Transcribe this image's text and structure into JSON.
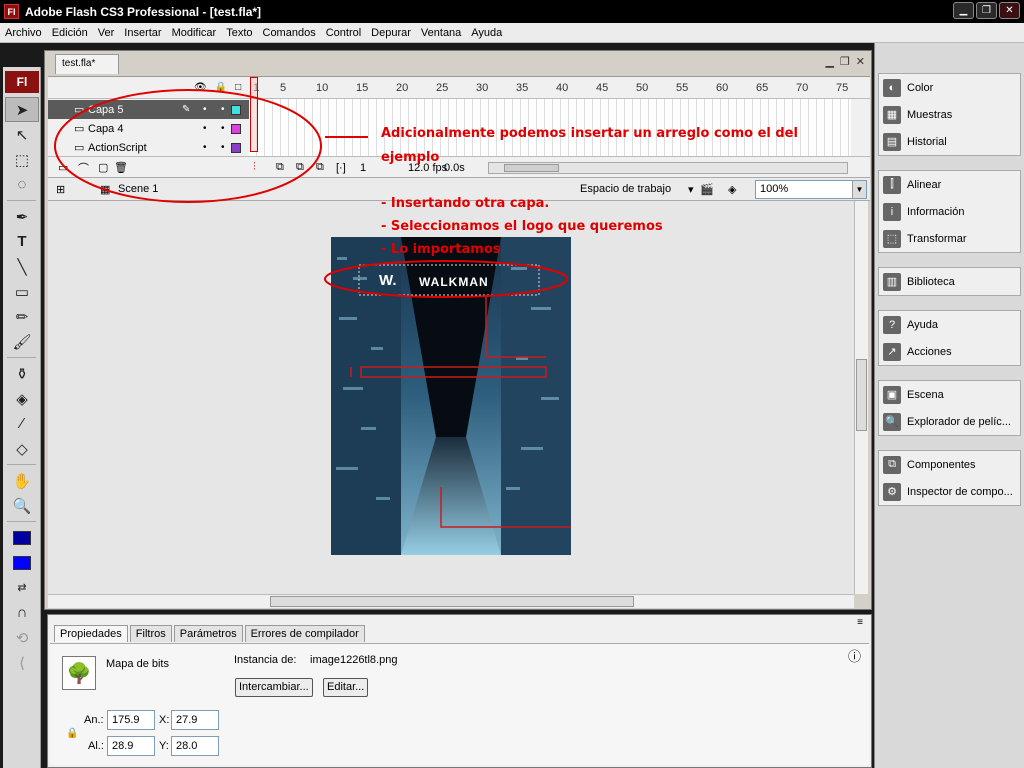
{
  "window": {
    "title": "Adobe Flash CS3 Professional - [test.fla*]",
    "app_icon": "Fl"
  },
  "menu": [
    "Archivo",
    "Edición",
    "Ver",
    "Insertar",
    "Modificar",
    "Texto",
    "Comandos",
    "Control",
    "Depurar",
    "Ventana",
    "Ayuda"
  ],
  "document": {
    "tab": "test.fla*"
  },
  "timeline": {
    "ruler": [
      "1",
      "5",
      "10",
      "15",
      "20",
      "25",
      "30",
      "35",
      "40",
      "45",
      "50",
      "55",
      "60",
      "65",
      "70",
      "75"
    ],
    "layers": [
      {
        "name": "Capa 5",
        "color": "#3fe0e0",
        "selected": true
      },
      {
        "name": "Capa 4",
        "color": "#e040e0",
        "selected": false
      },
      {
        "name": "ActionScript",
        "color": "#8b3fc8",
        "selected": false
      }
    ],
    "current_frame": "1",
    "fps": "12.0 fps",
    "time": "0.0s"
  },
  "editbar": {
    "scene": "Scene 1",
    "workspace": "Espacio de trabajo",
    "zoom": "100%"
  },
  "stage": {
    "logo_text": "WALKMAN",
    "logo_mark": "W."
  },
  "annotations": {
    "line1": "Adicionalmente podemos insertar un arreglo como el del",
    "line2": "ejemplo",
    "step1": "- Insertando otra capa.",
    "step2": "- Seleccionamos el logo que queremos",
    "step3": "- Lo importamos"
  },
  "properties": {
    "tabs": [
      "Propiedades",
      "Filtros",
      "Parámetros",
      "Errores de compilador"
    ],
    "type": "Mapa de bits",
    "instance_label": "Instancia de:",
    "instance_value": "image1226tl8.png",
    "swap_button": "Intercambiar...",
    "edit_button": "Editar...",
    "w_label": "An.:",
    "w_value": "175.9",
    "h_label": "Al.:",
    "h_value": "28.9",
    "x_label": "X:",
    "x_value": "27.9",
    "y_label": "Y:",
    "y_value": "28.0"
  },
  "panels": {
    "group1": [
      "Color",
      "Muestras",
      "Historial"
    ],
    "group2": [
      "Alinear",
      "Información",
      "Transformar"
    ],
    "group3": [
      "Biblioteca"
    ],
    "group4": [
      "Ayuda",
      "Acciones"
    ],
    "group5": [
      "Escena",
      "Explorador de pelíc..."
    ],
    "group6": [
      "Componentes",
      "Inspector de compo..."
    ]
  },
  "colors": {
    "accent_red": "#e00000",
    "stroke_color": "#0000a0",
    "fill_color": "#0000ff"
  }
}
